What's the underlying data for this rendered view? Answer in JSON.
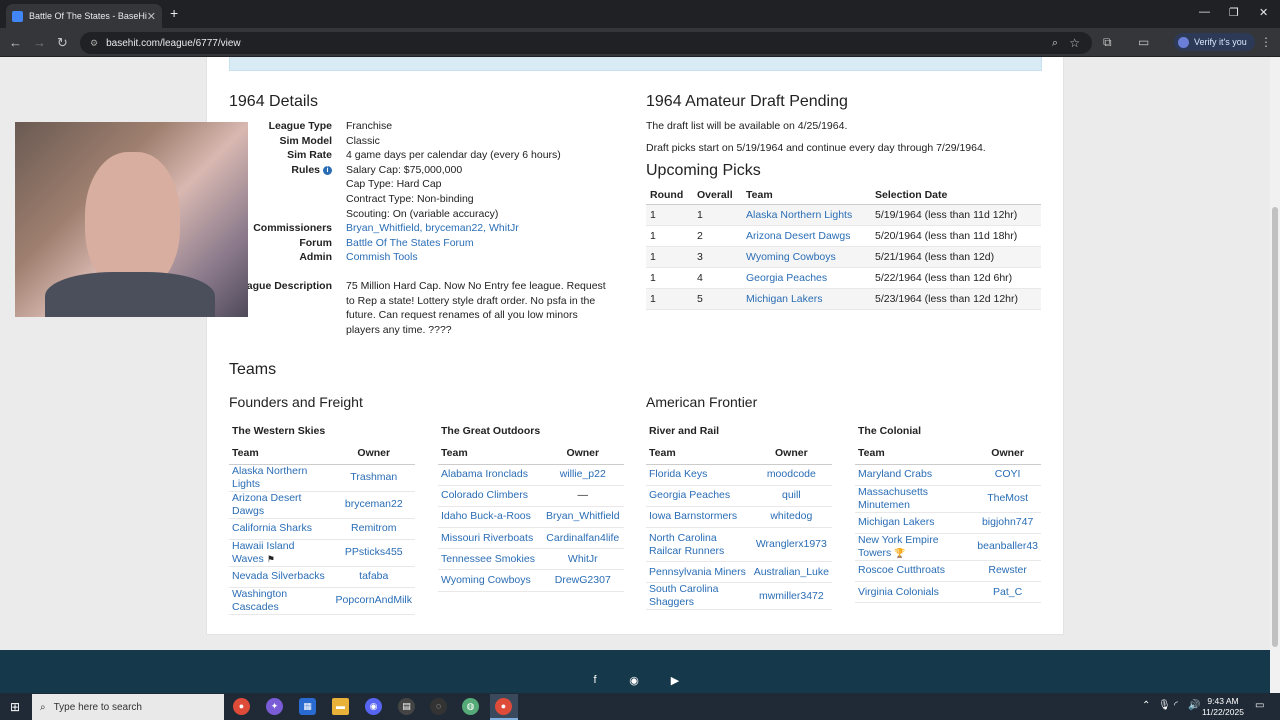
{
  "browser": {
    "tab_title": "Battle Of The States - BaseHit, a",
    "url": "basehit.com/league/6777/view",
    "verify_label": "Verify it's you"
  },
  "details": {
    "title": "1964 Details",
    "rows": [
      {
        "k": "League Type",
        "v": "Franchise"
      },
      {
        "k": "Sim Model",
        "v": "Classic"
      },
      {
        "k": "Sim Rate",
        "v": "4 game days per calendar day (every 6 hours)"
      },
      {
        "k": "Rules",
        "v": "Salary Cap: $75,000,000"
      },
      {
        "k": "",
        "v": "Cap Type: Hard Cap"
      },
      {
        "k": "",
        "v": "Contract Type: Non-binding"
      },
      {
        "k": "",
        "v": "Scouting: On (variable accuracy)"
      },
      {
        "k": "Commissioners",
        "v": "Bryan_Whitfield, bryceman22, WhitJr"
      },
      {
        "k": "Forum",
        "v": "Battle Of The States Forum"
      },
      {
        "k": "Admin",
        "v": "Commish Tools"
      }
    ],
    "desc_label": "League Description",
    "desc": "75 Million Hard Cap. Now No Entry fee league. Request to Rep a state! Lottery style draft order. No psfa in the future. Can request renames of all you low minors players any time. ????"
  },
  "draft": {
    "title": "1964 Amateur Draft Pending",
    "line1": "The draft list will be available on 4/25/1964.",
    "line2": "Draft picks start on 5/19/1964 and continue every day through 7/29/1964.",
    "picks_title": "Upcoming Picks",
    "headers": [
      "Round",
      "Overall",
      "Team",
      "Selection Date"
    ],
    "picks": [
      [
        "1",
        "1",
        "Alaska Northern Lights",
        "5/19/1964 (less than 11d 12hr)"
      ],
      [
        "1",
        "2",
        "Arizona Desert Dawgs",
        "5/20/1964 (less than 11d 18hr)"
      ],
      [
        "1",
        "3",
        "Wyoming Cowboys",
        "5/21/1964 (less than 12d)"
      ],
      [
        "1",
        "4",
        "Georgia Peaches",
        "5/22/1964 (less than 12d 6hr)"
      ],
      [
        "1",
        "5",
        "Michigan Lakers",
        "5/23/1964 (less than 12d 12hr)"
      ]
    ]
  },
  "teams": {
    "title": "Teams",
    "team_header": "Team",
    "owner_header": "Owner",
    "conferences": [
      {
        "name": "Founders and Freight",
        "divisions": [
          {
            "name": "The Western Skies",
            "rows": [
              [
                "Alaska Northern Lights",
                "Trashman"
              ],
              [
                "Arizona Desert Dawgs",
                "bryceman22"
              ],
              [
                "California Sharks",
                "Remitrom"
              ],
              [
                "Hawaii Island Waves",
                "PPsticks455"
              ],
              [
                "Nevada Silverbacks",
                "tafaba"
              ],
              [
                "Washington Cascades",
                "PopcornAndMilk"
              ]
            ]
          },
          {
            "name": "The Great Outdoors",
            "rows": [
              [
                "Alabama Ironclads",
                "willie_p22"
              ],
              [
                "Colorado Climbers",
                "—"
              ],
              [
                "Idaho Buck-a-Roos",
                "Bryan_Whitfield"
              ],
              [
                "Missouri Riverboats",
                "Cardinalfan4life"
              ],
              [
                "Tennessee Smokies",
                "WhitJr"
              ],
              [
                "Wyoming Cowboys",
                "DrewG2307"
              ]
            ]
          }
        ]
      },
      {
        "name": "American Frontier",
        "divisions": [
          {
            "name": "River and Rail",
            "rows": [
              [
                "Florida Keys",
                "moodcode"
              ],
              [
                "Georgia Peaches",
                "quill"
              ],
              [
                "Iowa Barnstormers",
                "whitedog"
              ],
              [
                "North Carolina Railcar Runners",
                "Wranglerx1973"
              ],
              [
                "Pennsylvania Miners",
                "Australian_Luke"
              ],
              [
                "South Carolina Shaggers",
                "mwmiller3472"
              ]
            ]
          },
          {
            "name": "The Colonial",
            "rows": [
              [
                "Maryland Crabs",
                "COYI"
              ],
              [
                "Massachusetts Minutemen",
                "TheMost"
              ],
              [
                "Michigan Lakers",
                "bigjohn747"
              ],
              [
                "New York Empire Towers",
                "beanballer43"
              ],
              [
                "Roscoe Cutthroats",
                "Rewster"
              ],
              [
                "Virginia Colonials",
                "Pat_C"
              ]
            ]
          }
        ]
      }
    ]
  },
  "taskbar": {
    "search_placeholder": "Type here to search",
    "time": "9:43 AM",
    "date": "11/22/2025"
  }
}
